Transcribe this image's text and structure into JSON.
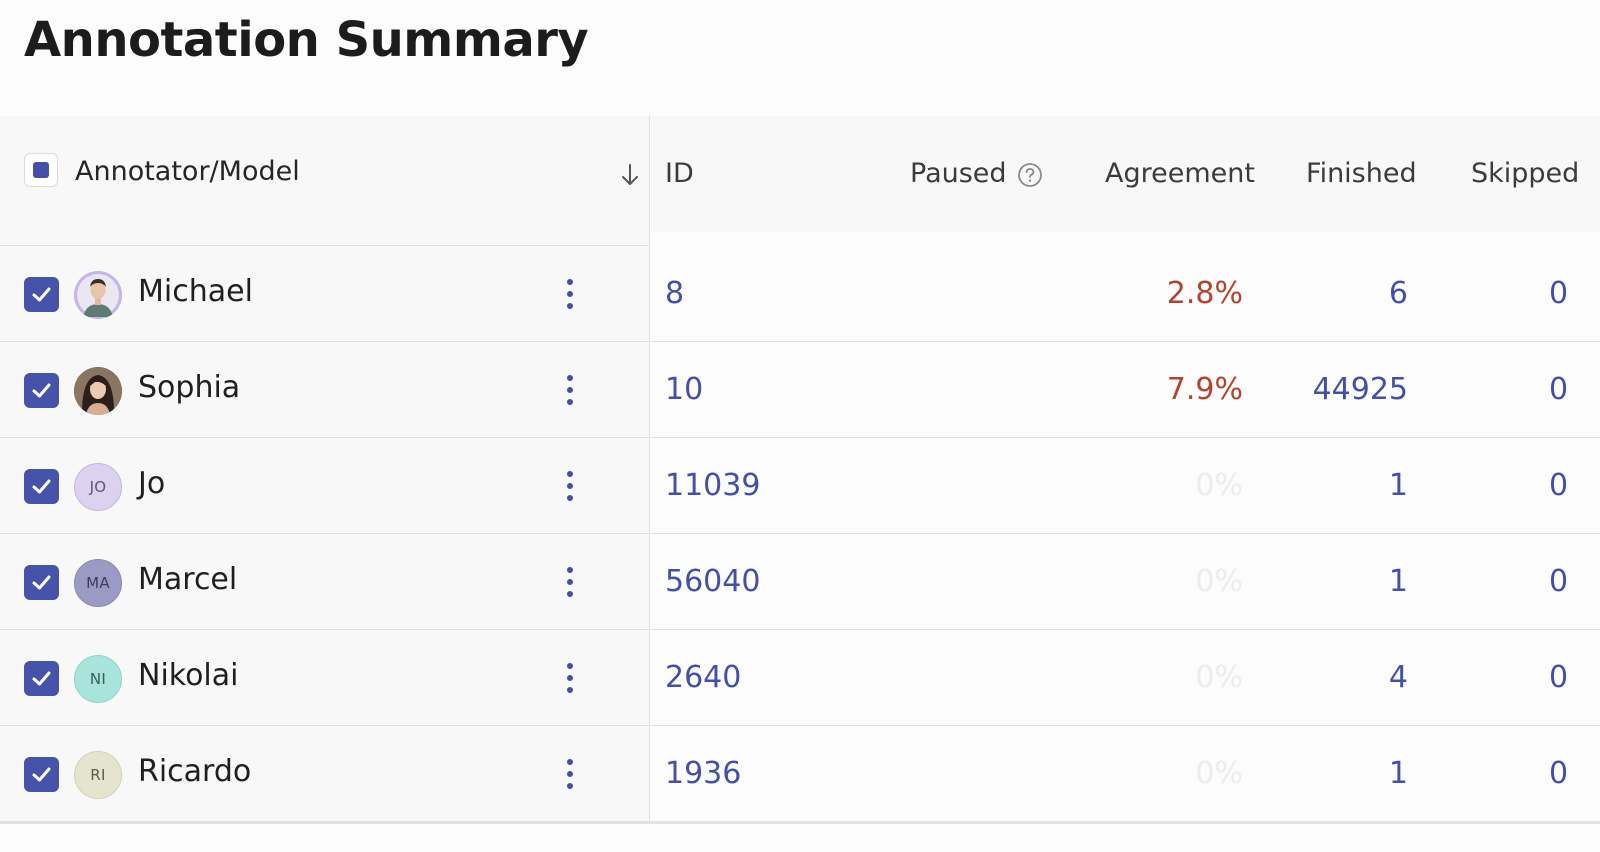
{
  "page": {
    "title": "Annotation Summary"
  },
  "table": {
    "columns": {
      "annotator": "Annotator/Model",
      "id": "ID",
      "paused": "Paused",
      "agreement": "Agreement",
      "finished": "Finished",
      "skipped": "Skipped"
    },
    "rows": [
      {
        "name": "Michael",
        "avatar": "photo",
        "initials": "",
        "id": "8",
        "agreement": "2.8%",
        "finished": "6",
        "skipped": "0"
      },
      {
        "name": "Sophia",
        "avatar": "photo",
        "initials": "",
        "id": "10",
        "agreement": "7.9%",
        "finished": "44925",
        "skipped": "0"
      },
      {
        "name": "Jo",
        "avatar": "initials",
        "initials": "JO",
        "id": "11039",
        "agreement": "0%",
        "finished": "1",
        "skipped": "0"
      },
      {
        "name": "Marcel",
        "avatar": "initials",
        "initials": "MA",
        "id": "56040",
        "agreement": "0%",
        "finished": "1",
        "skipped": "0"
      },
      {
        "name": "Nikolai",
        "avatar": "initials",
        "initials": "NI",
        "id": "2640",
        "agreement": "0%",
        "finished": "4",
        "skipped": "0"
      },
      {
        "name": "Ricardo",
        "avatar": "initials",
        "initials": "RI",
        "id": "1936",
        "agreement": "0%",
        "finished": "1",
        "skipped": "0"
      }
    ]
  },
  "colors": {
    "accent": "#4450a8",
    "low_agreement": "#b3432f",
    "zero_agreement": "#ececec",
    "avatar_jo": "#d9d0ee",
    "avatar_ma": "#9b9ac4",
    "avatar_ni": "#a8e4dc",
    "avatar_ri": "#e5e5cf"
  },
  "icons": {
    "select_all": "indeterminate-checkbox-icon",
    "sort": "arrow-down-icon",
    "paused_help": "question-circle-icon",
    "row_check": "check-icon",
    "row_menu": "kebab-menu-icon"
  }
}
